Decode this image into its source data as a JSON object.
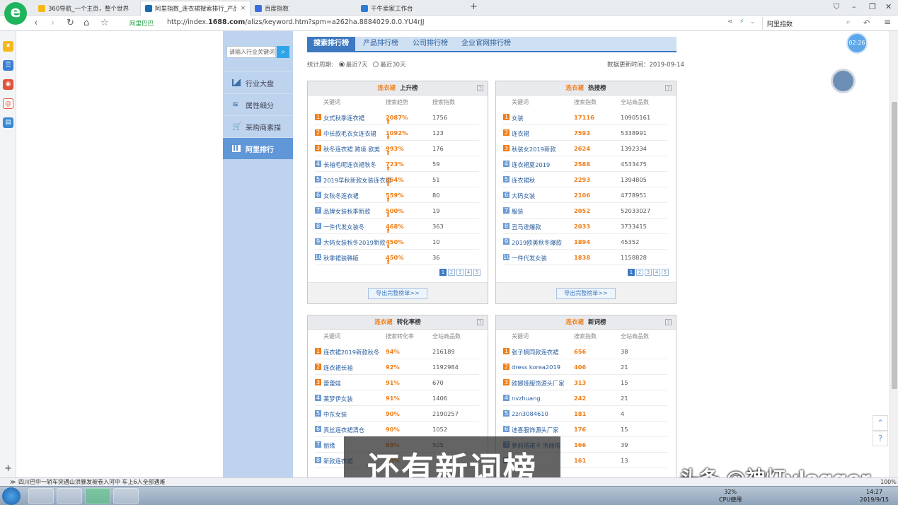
{
  "browser": {
    "tabs": [
      {
        "title": "360导航_一个主页，整个世界",
        "icon_color": "#f6b91a"
      },
      {
        "title": "阿里指数_连衣裙搜索排行_产品...",
        "icon_color": "#1a6ab3"
      },
      {
        "title": "百度指数",
        "icon_color": "#3a6ee0"
      },
      {
        "title": "千牛卖家工作台",
        "icon_color": "#2d7cd6"
      }
    ],
    "new_tab": "+",
    "site_label": "阿里巴巴",
    "url_prefix": "http://index.",
    "url_host": "1688.com",
    "url_path": "/alizs/keyword.htm?spm=a262ha.8884029.0.0.YU4rJJ",
    "search_box": "阿里指数",
    "timer": "02:26"
  },
  "sidebar": {
    "search_placeholder": "请输入行业关键词",
    "items": [
      {
        "label": "行业大盘",
        "icon": "chart-area-icon"
      },
      {
        "label": "属性细分",
        "icon": "layers-icon"
      },
      {
        "label": "采购商素描",
        "icon": "cart-icon"
      },
      {
        "label": "阿里排行",
        "icon": "bar-chart-icon",
        "active": true
      }
    ]
  },
  "tabs": [
    "搜索排行榜",
    "产品排行榜",
    "公司排行榜",
    "企业官网排行榜"
  ],
  "period": {
    "label": "统计周期:",
    "opt1": "最近7天",
    "opt2": "最近30天"
  },
  "updated": "数据更新时间：2019-09-14",
  "keyword": "连衣裙",
  "panels": {
    "rise": {
      "title": "上升榜",
      "cols": [
        "关键词",
        "搜索趋势",
        "搜索指数"
      ],
      "rows": [
        {
          "rank": "1",
          "name": "女式秋季连衣裙",
          "value": "2087%",
          "num": "1756"
        },
        {
          "rank": "2",
          "name": "中长款毛衣女连衣裙",
          "value": "1092%",
          "num": "123"
        },
        {
          "rank": "3",
          "name": "秋冬连衣裙 跨境 欧美",
          "value": "993%",
          "num": "176"
        },
        {
          "rank": "4",
          "name": "长袖毛呢连衣裙秋冬",
          "value": "723%",
          "num": "59"
        },
        {
          "rank": "5",
          "name": "2019早秋新款女装连衣裙",
          "value": "564%",
          "num": "51"
        },
        {
          "rank": "6",
          "name": "女秋冬连衣裙",
          "value": "559%",
          "num": "80"
        },
        {
          "rank": "7",
          "name": "品牌女装秋季新款",
          "value": "500%",
          "num": "19"
        },
        {
          "rank": "8",
          "name": "一件代发女装冬",
          "value": "468%",
          "num": "363"
        },
        {
          "rank": "9",
          "name": "大码女装秋冬2019新款",
          "value": "450%",
          "num": "10"
        },
        {
          "rank": "10",
          "name": "秋季裙装韩版",
          "value": "450%",
          "num": "36"
        }
      ],
      "pages": [
        "1",
        "2",
        "3",
        "4",
        "5"
      ],
      "export": "导出完整榜单>>"
    },
    "hot": {
      "title": "热搜榜",
      "cols": [
        "关键词",
        "搜索指数",
        "全站商品数"
      ],
      "rows": [
        {
          "rank": "1",
          "name": "女装",
          "value": "17116",
          "num": "10905161"
        },
        {
          "rank": "2",
          "name": "连衣裙",
          "value": "7593",
          "num": "5338991"
        },
        {
          "rank": "3",
          "name": "秋装女2019新款",
          "value": "2624",
          "num": "1392334"
        },
        {
          "rank": "4",
          "name": "连衣裙夏2019",
          "value": "2588",
          "num": "4533475"
        },
        {
          "rank": "5",
          "name": "连衣裙秋",
          "value": "2293",
          "num": "1394805"
        },
        {
          "rank": "6",
          "name": "大码女装",
          "value": "2106",
          "num": "4778951"
        },
        {
          "rank": "7",
          "name": "服装",
          "value": "2052",
          "num": "52033027"
        },
        {
          "rank": "8",
          "name": "丑马逊爆款",
          "value": "2033",
          "num": "3733415"
        },
        {
          "rank": "9",
          "name": "2019欧美秋冬爆款",
          "value": "1894",
          "num": "45352"
        },
        {
          "rank": "10",
          "name": "一件代发女装",
          "value": "1838",
          "num": "1158828"
        }
      ],
      "pages": [
        "1",
        "2",
        "3",
        "4",
        "5"
      ],
      "export": "导出完整榜单>>"
    },
    "conv": {
      "title": "转化率榜",
      "cols": [
        "关键词",
        "搜索转化率",
        "全站商品数"
      ],
      "rows": [
        {
          "rank": "1",
          "name": "连衣裙2019新款秋冬",
          "value": "94%",
          "num": "216189"
        },
        {
          "rank": "2",
          "name": "连衣裙长袖",
          "value": "92%",
          "num": "1192984"
        },
        {
          "rank": "3",
          "name": "蕾蕾娃",
          "value": "91%",
          "num": "670"
        },
        {
          "rank": "4",
          "name": "莱梦伊女装",
          "value": "91%",
          "num": "1406"
        },
        {
          "rank": "5",
          "name": "中东女装",
          "value": "90%",
          "num": "2190257"
        },
        {
          "rank": "6",
          "name": "真丝连衣裙清仓",
          "value": "90%",
          "num": "1052"
        },
        {
          "rank": "7",
          "name": "丽缘",
          "value": "89%",
          "num": "505"
        },
        {
          "rank": "8",
          "name": "新款连衣裙",
          "value": "89%",
          "num": ""
        }
      ]
    },
    "new": {
      "title": "新词榜",
      "cols": [
        "关键词",
        "搜索指数",
        "全站商品数"
      ],
      "rows": [
        {
          "rank": "1",
          "name": "张子枫同款连衣裙",
          "value": "656",
          "num": "38"
        },
        {
          "rank": "2",
          "name": "dress korea2019",
          "value": "406",
          "num": "21"
        },
        {
          "rank": "3",
          "name": "欧娜娅服饰源头厂家",
          "value": "313",
          "num": "15"
        },
        {
          "rank": "4",
          "name": "nvzhuang",
          "value": "242",
          "num": "21"
        },
        {
          "rank": "5",
          "name": "2zn3084610",
          "value": "181",
          "num": "4"
        },
        {
          "rank": "6",
          "name": "迪喜服饰源头厂家",
          "value": "176",
          "num": "15"
        },
        {
          "rank": "7",
          "name": "萝莉塔裙子 洛丽塔",
          "value": "166",
          "num": "39"
        },
        {
          "rank": "8",
          "name": "",
          "value": "161",
          "num": "13"
        }
      ]
    }
  },
  "overlay": {
    "subtitle": "还有新词榜",
    "watermark": "头条 @神灯vlogger"
  },
  "status": {
    "news": "四川巴中一轿车突遇山洪暴发被卷入河中 车上6人全部遇难",
    "zoom": "100%"
  },
  "taskbar": {
    "cpu": "32%",
    "cpu_label": "CPU使用",
    "time": "14:27",
    "date": "2019/9/15"
  },
  "colors": {
    "accent": "#3d78c2",
    "orange": "#f07d17",
    "sidebar": "#bdd3ee"
  }
}
